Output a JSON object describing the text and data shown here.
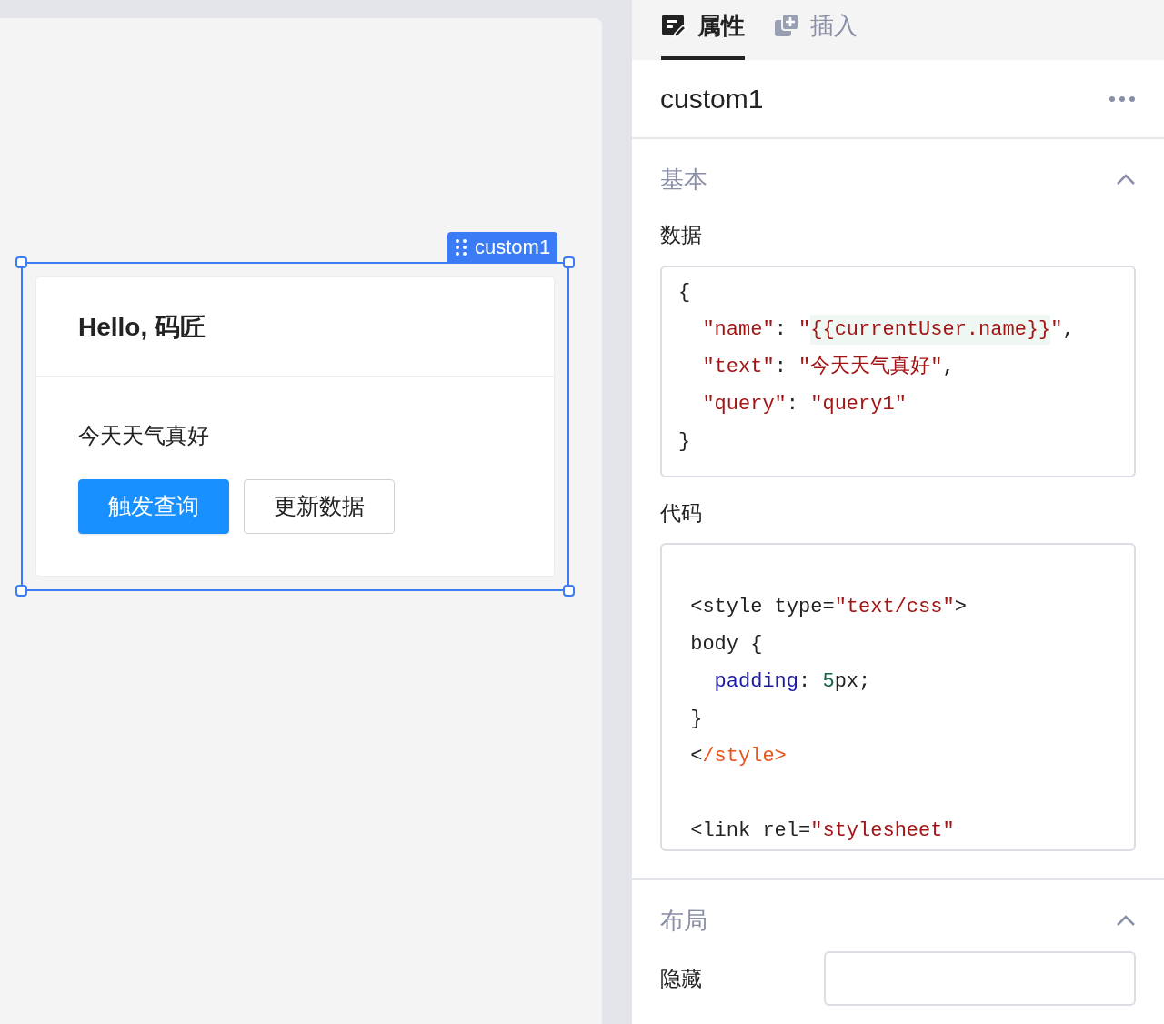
{
  "canvas": {
    "component": {
      "label": "custom1",
      "selected": true,
      "title": "Hello, 码匠",
      "text": "今天天气真好",
      "buttons": [
        {
          "label": "触发查询",
          "kind": "primary"
        },
        {
          "label": "更新数据",
          "kind": "default"
        }
      ]
    }
  },
  "panel": {
    "tabs": [
      {
        "label": "属性",
        "selected": true
      },
      {
        "label": "插入",
        "selected": false
      }
    ],
    "component_name": "custom1",
    "sections": [
      {
        "title": "基本",
        "expanded": true,
        "fields": [
          {
            "label": "数据",
            "kind": "code",
            "lines": [
              {
                "blank_before": false,
                "tokens": [
                  {
                    "text": "{",
                    "kind": "plain"
                  }
                ]
              },
              {
                "blank_before": false,
                "tokens": [
                  {
                    "text": "  \"name\"",
                    "kind": "string"
                  },
                  {
                    "text": ": ",
                    "kind": "plain"
                  },
                  {
                    "text": "\"",
                    "kind": "string"
                  },
                  {
                    "text": "{{currentUser.name}}",
                    "kind": "template"
                  },
                  {
                    "text": "\"",
                    "kind": "string"
                  },
                  {
                    "text": ",",
                    "kind": "plain"
                  }
                ]
              },
              {
                "blank_before": false,
                "tokens": [
                  {
                    "text": "  \"text\"",
                    "kind": "string"
                  },
                  {
                    "text": ": ",
                    "kind": "plain"
                  },
                  {
                    "text": "\"今天天气真好\"",
                    "kind": "string"
                  },
                  {
                    "text": ",",
                    "kind": "plain"
                  }
                ]
              },
              {
                "blank_before": false,
                "tokens": [
                  {
                    "text": "  \"query\"",
                    "kind": "string"
                  },
                  {
                    "text": ": ",
                    "kind": "plain"
                  },
                  {
                    "text": "\"query1\"",
                    "kind": "string"
                  }
                ]
              },
              {
                "blank_before": false,
                "tokens": [
                  {
                    "text": "}",
                    "kind": "plain"
                  }
                ]
              }
            ]
          },
          {
            "label": "代码",
            "kind": "code",
            "lines": [
              {
                "blank_before": true,
                "tokens": [
                  {
                    "text": " <style type=",
                    "kind": "plain"
                  },
                  {
                    "text": "\"text/css\"",
                    "kind": "string"
                  },
                  {
                    "text": ">",
                    "kind": "plain"
                  }
                ]
              },
              {
                "blank_before": false,
                "tokens": [
                  {
                    "text": " body {",
                    "kind": "plain"
                  }
                ]
              },
              {
                "blank_before": false,
                "tokens": [
                  {
                    "text": "   padding",
                    "kind": "property"
                  },
                  {
                    "text": ": ",
                    "kind": "plain"
                  },
                  {
                    "text": "5",
                    "kind": "number"
                  },
                  {
                    "text": "px;",
                    "kind": "plain"
                  }
                ]
              },
              {
                "blank_before": false,
                "tokens": [
                  {
                    "text": " }",
                    "kind": "plain"
                  }
                ]
              },
              {
                "blank_before": false,
                "tokens": [
                  {
                    "text": " <",
                    "kind": "plain"
                  },
                  {
                    "text": "/style>",
                    "kind": "tag"
                  }
                ]
              },
              {
                "blank_before": true,
                "tokens": [
                  {
                    "text": " <link rel=",
                    "kind": "plain"
                  },
                  {
                    "text": "\"stylesheet\"",
                    "kind": "string"
                  }
                ]
              }
            ]
          }
        ]
      },
      {
        "title": "布局",
        "expanded": true,
        "fields": [
          {
            "label": "隐藏",
            "kind": "input"
          }
        ]
      }
    ]
  }
}
